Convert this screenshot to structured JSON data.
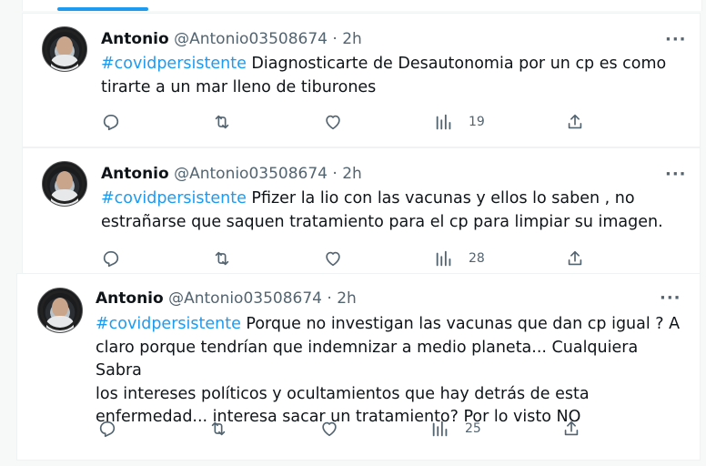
{
  "tweets": [
    {
      "name": "Antonio",
      "handle": "@Antonio03508674",
      "dot": "·",
      "time": "2h",
      "hashtag": "#covidpersistente",
      "text_line1": " Diagnosticarte de Desautonomia por un cp es como",
      "text_rest": [
        "tirarte a un mar lleno de tiburones"
      ],
      "views": "19"
    },
    {
      "name": "Antonio",
      "handle": "@Antonio03508674",
      "dot": "·",
      "time": "2h",
      "hashtag": "#covidpersistente",
      "text_line1": " Pfizer la lio con las vacunas y ellos lo saben , no",
      "text_rest": [
        "estrañarse que saquen tratamiento para el cp para limpiar su imagen."
      ],
      "views": "28"
    },
    {
      "name": "Antonio",
      "handle": "@Antonio03508674",
      "dot": "·",
      "time": "2h",
      "hashtag": "#covidpersistente",
      "text_line1": " Porque no investigan las vacunas que dan cp igual ? A",
      "text_rest": [
        "claro porque tendrían que indemnizar a medio planeta... Cualquiera Sabra",
        "los intereses políticos y ocultamientos que hay detrás de esta",
        "enfermedad... interesa sacar un tratamiento? Por lo visto NO"
      ],
      "views": "25"
    }
  ],
  "more_label": "···",
  "colors": {
    "accent": "#1d9bf0",
    "secondary_text": "#536471",
    "text": "#0f1419"
  },
  "icons": [
    "reply-icon",
    "retweet-icon",
    "like-icon",
    "views-icon",
    "share-icon",
    "more-icon"
  ]
}
